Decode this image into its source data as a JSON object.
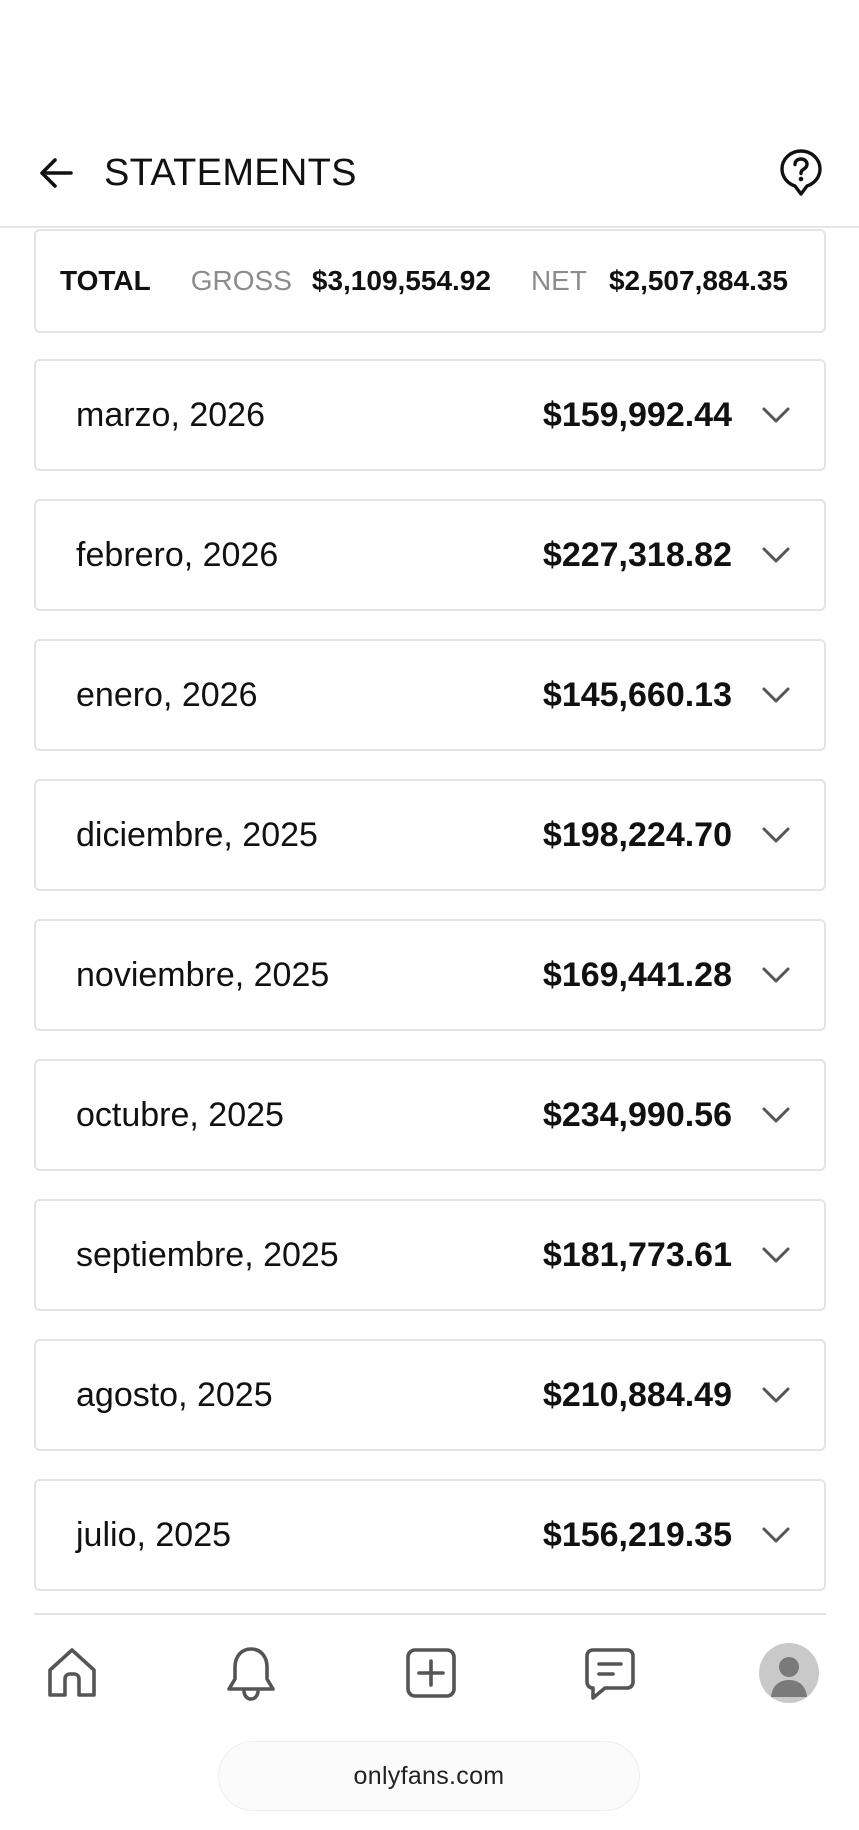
{
  "header": {
    "title": "STATEMENTS",
    "back_icon": "arrow-left-icon",
    "help_icon": "help-circle-icon"
  },
  "total": {
    "label": "TOTAL",
    "gross_label": "GROSS",
    "gross_value": "$3,109,554.92",
    "net_label": "NET",
    "net_value": "$2,507,884.35"
  },
  "statements": [
    {
      "label": "marzo, 2026",
      "amount": "$159,992.44"
    },
    {
      "label": "febrero, 2026",
      "amount": "$227,318.82"
    },
    {
      "label": "enero, 2026",
      "amount": "$145,660.13"
    },
    {
      "label": "diciembre, 2025",
      "amount": "$198,224.70"
    },
    {
      "label": "noviembre, 2025",
      "amount": "$169,441.28"
    },
    {
      "label": "octubre, 2025",
      "amount": "$234,990.56"
    },
    {
      "label": "septiembre, 2025",
      "amount": "$181,773.61"
    },
    {
      "label": "agosto, 2025",
      "amount": "$210,884.49"
    },
    {
      "label": "julio, 2025",
      "amount": "$156,219.35"
    }
  ],
  "bottom_nav": {
    "items": [
      "home-icon",
      "bell-icon",
      "add-post-icon",
      "messages-icon",
      "avatar"
    ]
  },
  "browser": {
    "url": "onlyfans.com"
  },
  "colors": {
    "border": "#e3e3e3",
    "muted_text": "#8c8c8c",
    "icon": "#555555"
  }
}
